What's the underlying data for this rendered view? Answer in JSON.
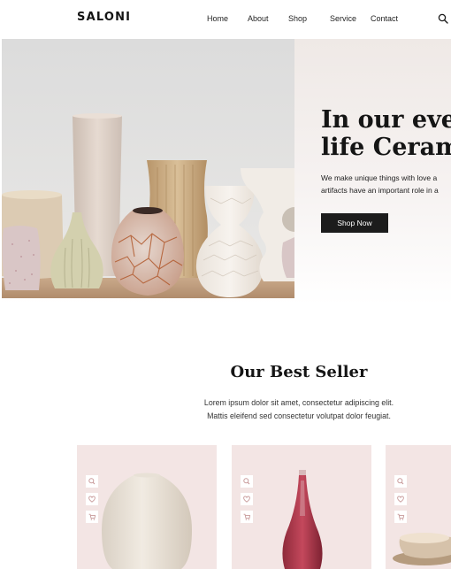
{
  "header": {
    "logo": "SALONI",
    "nav": [
      "Home",
      "About",
      "Shop",
      "Service",
      "Contact"
    ]
  },
  "hero": {
    "title_line1": "In our every",
    "title_line2": "life Cerami",
    "subtitle_line1": "We make unique things with love a",
    "subtitle_line2": "artifacts have an important role in a",
    "cta": "Shop Now"
  },
  "best_seller": {
    "title": "Our Best Seller",
    "text_line1": "Lorem ipsum dolor sit amet, consectetur adipiscing elit.",
    "text_line2": "Mattis eleifend sed consectetur volutpat dolor feugiat."
  },
  "icons": {
    "search": "search-icon",
    "card_actions": [
      "search-icon",
      "heart-icon",
      "cart-icon"
    ]
  },
  "colors": {
    "accent": "#1c1c1c",
    "card_bg": "#f3e5e4"
  }
}
